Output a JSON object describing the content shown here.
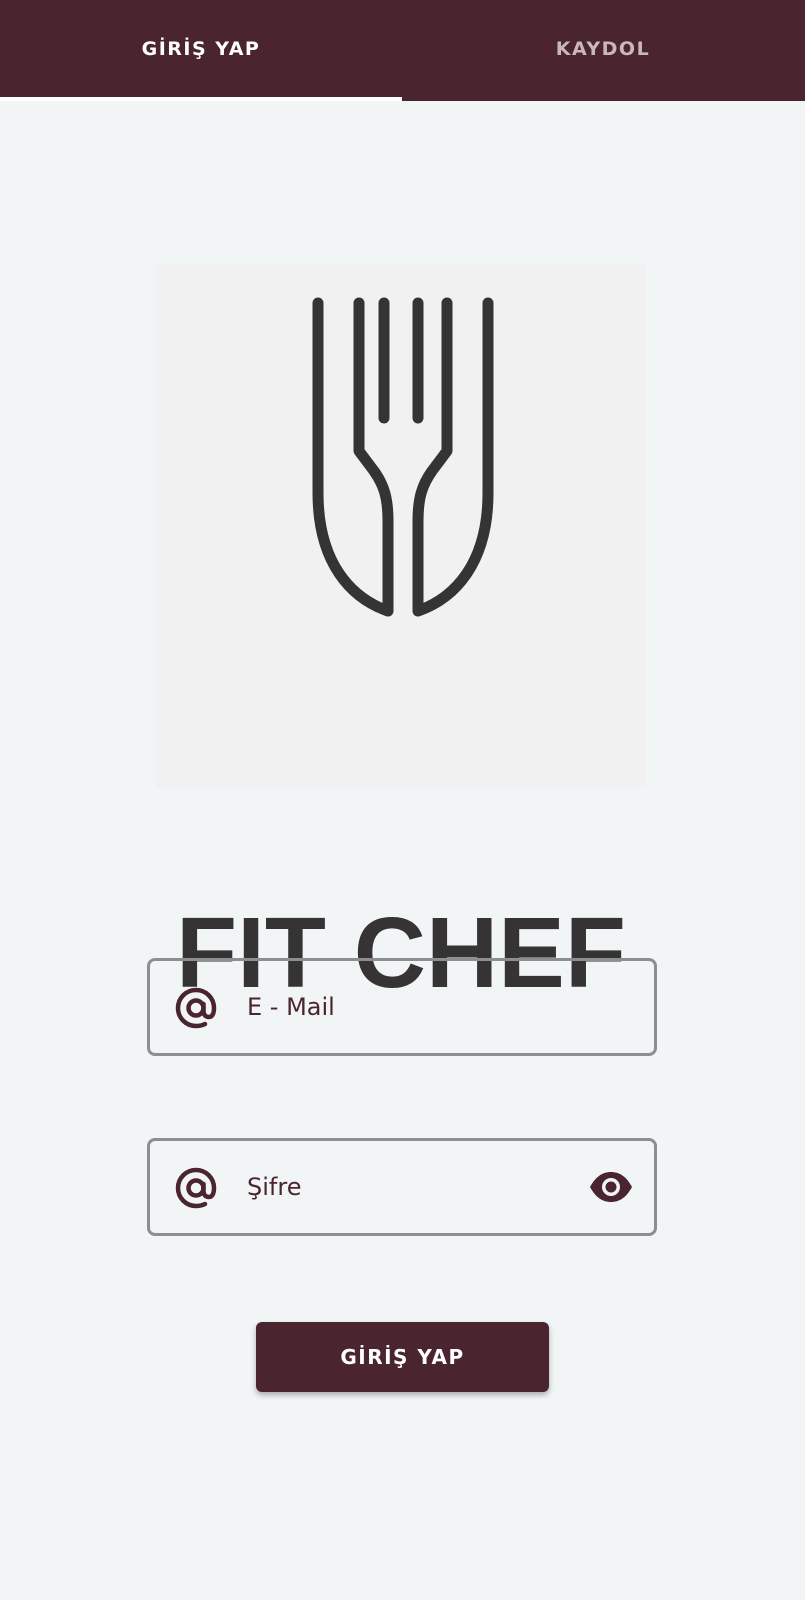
{
  "tabs": {
    "login_label": "GİRİŞ YAP",
    "register_label": "KAYDOL",
    "active": "login"
  },
  "logo": {
    "text": "FIT CHEF",
    "icon": "fork-icon"
  },
  "form": {
    "email_placeholder": "E - Mail",
    "email_value": "",
    "email_icon": "at-icon",
    "password_placeholder": "Şifre",
    "password_value": "",
    "password_icon": "at-icon",
    "password_toggle_icon": "eye-icon",
    "submit_label": "GİRİŞ YAP"
  },
  "colors": {
    "primary": "#4a242e",
    "background": "#f2f5f6",
    "field_border": "#8c8f91",
    "logo_ink": "#353333"
  }
}
